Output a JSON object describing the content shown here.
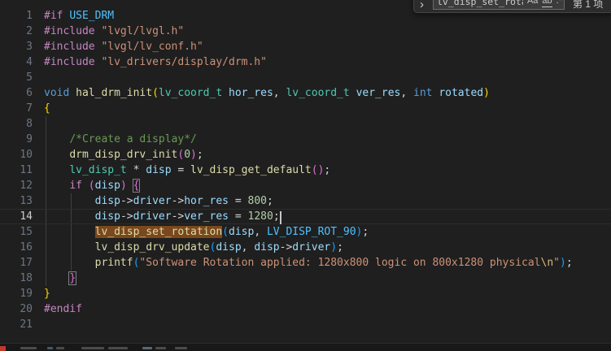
{
  "find_widget": {
    "toggle_replace_icon": "›",
    "query": "lv_disp_set_rotati",
    "match_case_label": "Aa",
    "whole_word_label": "ab",
    "regex_label": ".*",
    "matches_label": "第 1 项"
  },
  "colors": {
    "editor_bg": "#1F1F1F",
    "gutter_fg": "#6E7681",
    "gutter_active_fg": "#CCCCCC",
    "find_match_bg": "#7A481C",
    "bracket_match_border": "#808080",
    "current_line_border": "#2C2C2C",
    "indent_guide": "#404040",
    "cursor": "#C8C8C8",
    "widget_bg": "#2C2C2D",
    "widget_border": "#454545",
    "input_bg": "#3C3C3C",
    "input_border": "#6A6A6A",
    "input_fg": "#CCCCCC",
    "statusbar_bg": "#181818",
    "statusbar_remote_bg": "#C1392B",
    "tokens": {
      "pp": "#C586C0",
      "kw": "#C586C0",
      "kw2": "#569CD6",
      "fn": "#DCDCAA",
      "type": "#4EC9B0",
      "var": "#9CDCFE",
      "num": "#B5CEA8",
      "str": "#CE9178",
      "esc": "#D7BA7D",
      "com": "#6A9955",
      "t": "#D4D4D4",
      "b1": "#FFD700",
      "b2": "#DA70D6",
      "b3": "#179FFF",
      "macro": "#4FC1FF"
    }
  },
  "editor": {
    "lines": [
      {
        "num": 1,
        "tokens": [
          [
            "pp",
            "#if"
          ],
          [
            "t",
            " "
          ],
          [
            "macro",
            "USE_DRM"
          ]
        ]
      },
      {
        "num": 2,
        "tokens": [
          [
            "pp",
            "#include"
          ],
          [
            "t",
            " "
          ],
          [
            "str",
            "\"lvgl/lvgl.h\""
          ]
        ]
      },
      {
        "num": 3,
        "tokens": [
          [
            "pp",
            "#include"
          ],
          [
            "t",
            " "
          ],
          [
            "str",
            "\"lvgl/lv_conf.h\""
          ]
        ]
      },
      {
        "num": 4,
        "tokens": [
          [
            "pp",
            "#include"
          ],
          [
            "t",
            " "
          ],
          [
            "str",
            "\"lv_drivers/display/drm.h\""
          ]
        ]
      },
      {
        "num": 5,
        "tokens": []
      },
      {
        "num": 6,
        "tokens": [
          [
            "kw2",
            "void"
          ],
          [
            "t",
            " "
          ],
          [
            "fn",
            "hal_drm_init"
          ],
          [
            "b1",
            "("
          ],
          [
            "type",
            "lv_coord_t"
          ],
          [
            "t",
            " "
          ],
          [
            "var",
            "hor_res"
          ],
          [
            "t",
            ", "
          ],
          [
            "type",
            "lv_coord_t"
          ],
          [
            "t",
            " "
          ],
          [
            "var",
            "ver_res"
          ],
          [
            "t",
            ", "
          ],
          [
            "kw2",
            "int"
          ],
          [
            "t",
            " "
          ],
          [
            "var",
            "rotated"
          ],
          [
            "b1",
            ")"
          ]
        ]
      },
      {
        "num": 7,
        "tokens": [
          [
            "b1",
            "{"
          ]
        ]
      },
      {
        "num": 8,
        "tokens": []
      },
      {
        "num": 9,
        "tokens": [
          [
            "t",
            "    "
          ],
          [
            "com",
            "/*Create a display*/"
          ]
        ]
      },
      {
        "num": 10,
        "tokens": [
          [
            "t",
            "    "
          ],
          [
            "fn",
            "drm_disp_drv_init"
          ],
          [
            "b2",
            "("
          ],
          [
            "num",
            "0"
          ],
          [
            "b2",
            ")"
          ],
          [
            "t",
            ";"
          ]
        ]
      },
      {
        "num": 11,
        "tokens": [
          [
            "t",
            "    "
          ],
          [
            "type",
            "lv_disp_t"
          ],
          [
            "t",
            " * "
          ],
          [
            "var",
            "disp"
          ],
          [
            "t",
            " = "
          ],
          [
            "fn",
            "lv_disp_get_default"
          ],
          [
            "b2",
            "()"
          ],
          [
            "t",
            ";"
          ]
        ]
      },
      {
        "num": 12,
        "tokens": [
          [
            "t",
            "    "
          ],
          [
            "kw",
            "if"
          ],
          [
            "t",
            " "
          ],
          [
            "b2",
            "("
          ],
          [
            "var",
            "disp"
          ],
          [
            "b2",
            ")"
          ],
          [
            "t",
            " "
          ],
          [
            "b2",
            "{",
            "bracketbox"
          ]
        ]
      },
      {
        "num": 13,
        "tokens": [
          [
            "t",
            "        "
          ],
          [
            "var",
            "disp"
          ],
          [
            "t",
            "->"
          ],
          [
            "var",
            "driver"
          ],
          [
            "t",
            "->"
          ],
          [
            "var",
            "hor_res"
          ],
          [
            "t",
            " = "
          ],
          [
            "num",
            "800"
          ],
          [
            "t",
            ";"
          ]
        ]
      },
      {
        "num": 14,
        "current": true,
        "cursor": true,
        "tokens": [
          [
            "t",
            "        "
          ],
          [
            "var",
            "disp"
          ],
          [
            "t",
            "->"
          ],
          [
            "var",
            "driver"
          ],
          [
            "t",
            "->"
          ],
          [
            "var",
            "ver_res"
          ],
          [
            "t",
            " = "
          ],
          [
            "num",
            "1280"
          ],
          [
            "t",
            ";"
          ]
        ]
      },
      {
        "num": 15,
        "tokens": [
          [
            "t",
            "        "
          ],
          [
            "fn",
            "lv_disp_set_rotation",
            "findmatch"
          ],
          [
            "b3",
            "("
          ],
          [
            "var",
            "disp"
          ],
          [
            "t",
            ", "
          ],
          [
            "macro",
            "LV_DISP_ROT_90"
          ],
          [
            "b3",
            ")"
          ],
          [
            "t",
            ";"
          ]
        ]
      },
      {
        "num": 16,
        "tokens": [
          [
            "t",
            "        "
          ],
          [
            "fn",
            "lv_disp_drv_update"
          ],
          [
            "b3",
            "("
          ],
          [
            "var",
            "disp"
          ],
          [
            "t",
            ", "
          ],
          [
            "var",
            "disp"
          ],
          [
            "t",
            "->"
          ],
          [
            "var",
            "driver"
          ],
          [
            "b3",
            ")"
          ],
          [
            "t",
            ";"
          ]
        ]
      },
      {
        "num": 17,
        "tokens": [
          [
            "t",
            "        "
          ],
          [
            "fn",
            "printf"
          ],
          [
            "b3",
            "("
          ],
          [
            "str",
            "\"Software Rotation applied: 1280x800 logic on 800x1280 physical"
          ],
          [
            "esc",
            "\\n"
          ],
          [
            "str",
            "\""
          ],
          [
            "b3",
            ")"
          ],
          [
            "t",
            ";"
          ]
        ]
      },
      {
        "num": 18,
        "tokens": [
          [
            "t",
            "    "
          ],
          [
            "b2",
            "}",
            "bracketbox"
          ]
        ]
      },
      {
        "num": 19,
        "tokens": [
          [
            "b1",
            "}"
          ]
        ]
      },
      {
        "num": 20,
        "tokens": [
          [
            "pp",
            "#endif"
          ]
        ]
      },
      {
        "num": 21,
        "tokens": []
      }
    ],
    "guides": [
      {
        "col": 0,
        "from": 8,
        "to": 18
      },
      {
        "col": 4,
        "from": 13,
        "to": 17
      }
    ]
  }
}
